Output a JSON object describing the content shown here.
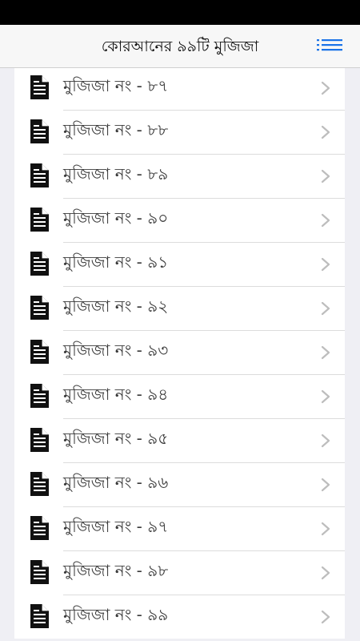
{
  "colors": {
    "status_bar": "#000000",
    "nav_background": "#f7f7f7",
    "accent": "#1a73e8",
    "list_background": "#ffffff",
    "page_background": "#efeff4",
    "chevron": "#bdbdbd"
  },
  "header": {
    "title": "কোরআনের ৯৯টি মুজিজা",
    "menu_icon": "list-menu-icon"
  },
  "list": {
    "item_icon": "document-icon",
    "trailing_icon": "chevron-right-icon",
    "items": [
      {
        "label": "মুজিজা নং - ৮৭"
      },
      {
        "label": "মুজিজা নং - ৮৮"
      },
      {
        "label": "মুজিজা নং - ৮৯"
      },
      {
        "label": "মুজিজা নং - ৯০"
      },
      {
        "label": "মুজিজা নং - ৯১"
      },
      {
        "label": "মুজিজা নং - ৯২"
      },
      {
        "label": "মুজিজা নং - ৯৩"
      },
      {
        "label": "মুজিজা নং - ৯৪"
      },
      {
        "label": "মুজিজা নং - ৯৫"
      },
      {
        "label": "মুজিজা নং - ৯৬"
      },
      {
        "label": "মুজিজা নং - ৯৭"
      },
      {
        "label": "মুজিজা নং - ৯৮"
      },
      {
        "label": "মুজিজা নং - ৯৯"
      }
    ]
  }
}
